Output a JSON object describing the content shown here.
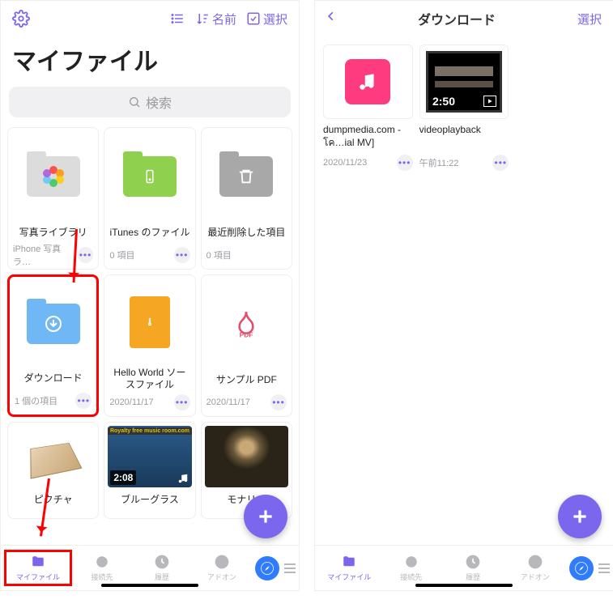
{
  "left": {
    "header": {
      "sort_label": "名前",
      "select_label": "選択"
    },
    "page_title": "マイファイル",
    "search_placeholder": "検索",
    "cards": [
      {
        "label": "写真ライブラリ",
        "meta": "iPhone 写真ラ…"
      },
      {
        "label": "iTunes のファイル",
        "meta": "0 項目"
      },
      {
        "label": "最近削除した項目",
        "meta": "0 項目"
      },
      {
        "label": "ダウンロード",
        "meta": "1 個の項目"
      },
      {
        "label": "Hello World ソースファイル",
        "meta": "2020/11/17"
      },
      {
        "label": "サンプル PDF",
        "meta": "2020/11/17"
      },
      {
        "label": "ピクチャ",
        "meta": ""
      },
      {
        "label": "ブルーグラス",
        "meta": "",
        "dur": "2:08"
      },
      {
        "label": "モナリ…",
        "meta": ""
      }
    ]
  },
  "right": {
    "header": {
      "title": "ダウンロード",
      "select_label": "選択"
    },
    "items": [
      {
        "label": "dumpmedia.com - โค…ial MV]",
        "meta": "2020/11/23"
      },
      {
        "label": "videoplayback",
        "meta": "午前11:22",
        "dur": "2:50"
      }
    ]
  },
  "tabs": {
    "myfiles": "マイファイル",
    "connect": "接続先",
    "history": "履歴",
    "addon": "アドオン"
  }
}
